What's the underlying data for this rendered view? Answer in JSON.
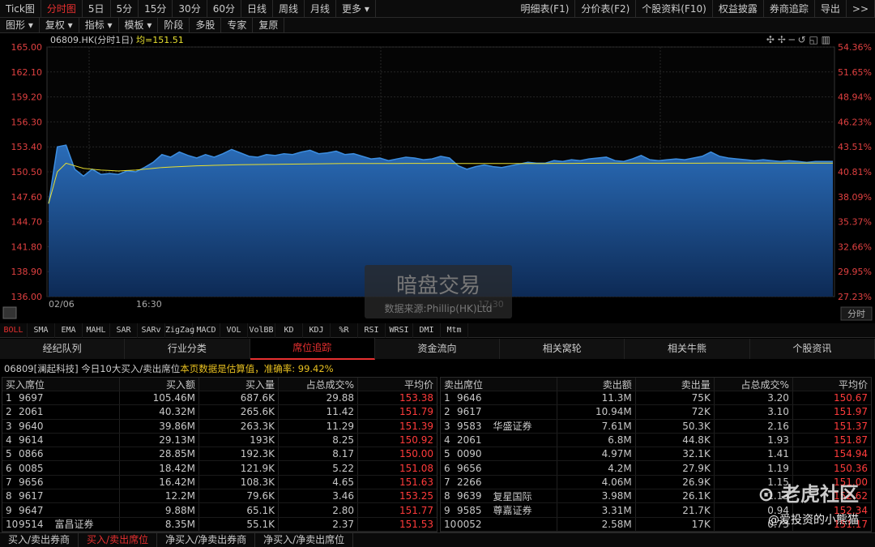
{
  "top_tabs": [
    "Tick图",
    "分时图",
    "5日",
    "5分",
    "15分",
    "30分",
    "60分",
    "日线",
    "周线",
    "月线",
    "更多 ▾"
  ],
  "top_right": [
    "明细表(F1)",
    "分价表(F2)",
    "个股资料(F10)",
    "权益披露",
    "券商追踪",
    "导出",
    ">>"
  ],
  "sub_tabs": [
    "图形 ▾",
    "复权 ▾",
    "指标 ▾",
    "模板 ▾",
    "阶段",
    "多股",
    "专家",
    "复原"
  ],
  "chart": {
    "title": "06809.HK(分时1日)",
    "avg_label": "均=151.51",
    "y_left": [
      "165.00",
      "162.10",
      "159.20",
      "156.30",
      "153.40",
      "150.50",
      "147.60",
      "144.70",
      "141.80",
      "138.90",
      "136.00"
    ],
    "y_right": [
      "54.36%",
      "51.65%",
      "48.94%",
      "46.23%",
      "43.51%",
      "40.81%",
      "38.09%",
      "35.37%",
      "32.66%",
      "29.95%",
      "27.23%"
    ],
    "x_labels": [
      "02/06",
      "16:30",
      "17:30"
    ],
    "period_btn": "分时",
    "watermark_title": "暗盘交易",
    "watermark_sub": "数据来源:Phillip(HK)Ltd",
    "toolbar": "✣ ✢ ─ ↺ ◱ ▥",
    "colors": {
      "fill": "#1e5a9e",
      "line": "#3d8ee0",
      "avg": "#e8e030",
      "ylabel": "#e04040"
    }
  },
  "chart_data": {
    "type": "area",
    "ylim": [
      136.0,
      165.0
    ],
    "price": [
      146.8,
      153.4,
      153.6,
      150.8,
      150.0,
      150.8,
      150.2,
      150.3,
      150.2,
      150.6,
      150.5,
      151.0,
      151.6,
      152.5,
      152.2,
      152.8,
      152.4,
      152.1,
      152.5,
      152.2,
      152.6,
      153.1,
      152.7,
      152.3,
      152.2,
      152.5,
      152.4,
      152.6,
      152.5,
      152.8,
      153.0,
      152.6,
      152.7,
      152.9,
      152.5,
      152.6,
      152.3,
      152.0,
      152.1,
      151.8,
      152.0,
      152.2,
      152.1,
      151.9,
      152.0,
      152.3,
      152.1,
      151.2,
      150.8,
      151.1,
      151.3,
      151.1,
      151.0,
      151.2,
      151.4,
      151.6,
      151.5,
      151.5,
      151.8,
      151.7,
      151.9,
      151.8,
      152.0,
      152.1,
      152.2,
      151.8,
      151.7,
      152.0,
      152.4,
      151.9,
      151.8,
      151.9,
      152.0,
      151.9,
      152.1,
      152.3,
      152.8,
      152.3,
      152.1,
      152.0,
      151.9,
      151.8,
      151.9,
      151.8,
      151.7,
      151.8,
      151.7,
      151.6,
      151.7,
      151.7,
      151.7
    ],
    "average": [
      146.8,
      150.5,
      151.5,
      151.2,
      150.9,
      150.8,
      150.7,
      150.65,
      150.6,
      150.65,
      150.7,
      150.8,
      150.9,
      151.0,
      151.05,
      151.1,
      151.15,
      151.2,
      151.22,
      151.25,
      151.28,
      151.3,
      151.32,
      151.34,
      151.35,
      151.36,
      151.37,
      151.38,
      151.4,
      151.41,
      151.42,
      151.43,
      151.44,
      151.45,
      151.46,
      151.47,
      151.47,
      151.47,
      151.47,
      151.47,
      151.47,
      151.48,
      151.48,
      151.48,
      151.48,
      151.48,
      151.48,
      151.47,
      151.46,
      151.46,
      151.46,
      151.46,
      151.46,
      151.46,
      151.46,
      151.47,
      151.47,
      151.47,
      151.48,
      151.48,
      151.48,
      151.49,
      151.49,
      151.49,
      151.5,
      151.5,
      151.5,
      151.5,
      151.5,
      151.5,
      151.5,
      151.5,
      151.5,
      151.5,
      151.5,
      151.5,
      151.51,
      151.51,
      151.51,
      151.51,
      151.51,
      151.51,
      151.51,
      151.51,
      151.51,
      151.51,
      151.51,
      151.51,
      151.51,
      151.51,
      151.51
    ]
  },
  "indicators": [
    "BOLL",
    "SMA",
    "EMA",
    "MAHL",
    "SAR",
    "SARv",
    "ZigZag",
    "MACD",
    "VOL",
    "VolBB",
    "KD",
    "KDJ",
    "%R",
    "RSI",
    "WRSI",
    "DMI",
    "Mtm"
  ],
  "nav_tabs": [
    "经纪队列",
    "行业分类",
    "席位追踪",
    "资金流向",
    "相关窝轮",
    "相关牛熊",
    "个股资讯"
  ],
  "info": {
    "text": "06809[澜起科技] 今日10大买入/卖出席位 ",
    "highlight": "本页数据是估算值，准确率: 99.42%"
  },
  "buy_headers": [
    "买入席位",
    "买入额",
    "买入量",
    "占总成交%",
    "平均价"
  ],
  "buy_rows": [
    [
      "1",
      "9697",
      "",
      "105.46M",
      "687.6K",
      "29.88",
      "153.38"
    ],
    [
      "2",
      "2061",
      "",
      "40.32M",
      "265.6K",
      "11.42",
      "151.79"
    ],
    [
      "3",
      "9640",
      "",
      "39.86M",
      "263.3K",
      "11.29",
      "151.39"
    ],
    [
      "4",
      "9614",
      "",
      "29.13M",
      "193K",
      "8.25",
      "150.92"
    ],
    [
      "5",
      "0866",
      "",
      "28.85M",
      "192.3K",
      "8.17",
      "150.00"
    ],
    [
      "6",
      "0085",
      "",
      "18.42M",
      "121.9K",
      "5.22",
      "151.08"
    ],
    [
      "7",
      "9656",
      "",
      "16.42M",
      "108.3K",
      "4.65",
      "151.63"
    ],
    [
      "8",
      "9617",
      "",
      "12.2M",
      "79.6K",
      "3.46",
      "153.25"
    ],
    [
      "9",
      "9647",
      "",
      "9.88M",
      "65.1K",
      "2.80",
      "151.77"
    ],
    [
      "10",
      "9514",
      "富昌证券",
      "8.35M",
      "55.1K",
      "2.37",
      "151.53"
    ]
  ],
  "sell_headers": [
    "卖出席位",
    "卖出额",
    "卖出量",
    "占总成交%",
    "平均价"
  ],
  "sell_rows": [
    [
      "1",
      "9646",
      "",
      "11.3M",
      "75K",
      "3.20",
      "150.67"
    ],
    [
      "2",
      "9617",
      "",
      "10.94M",
      "72K",
      "3.10",
      "151.97"
    ],
    [
      "3",
      "9583",
      "华盛证券",
      "7.61M",
      "50.3K",
      "2.16",
      "151.37"
    ],
    [
      "4",
      "2061",
      "",
      "6.8M",
      "44.8K",
      "1.93",
      "151.87"
    ],
    [
      "5",
      "0090",
      "",
      "4.97M",
      "32.1K",
      "1.41",
      "154.94"
    ],
    [
      "6",
      "9656",
      "",
      "4.2M",
      "27.9K",
      "1.19",
      "150.36"
    ],
    [
      "7",
      "2266",
      "",
      "4.06M",
      "26.9K",
      "1.15",
      "151.00"
    ],
    [
      "8",
      "9639",
      "复星国际",
      "3.98M",
      "26.1K",
      "1.13",
      "152.62"
    ],
    [
      "9",
      "9585",
      "尊嘉证券",
      "3.31M",
      "21.7K",
      "0.94",
      "152.34"
    ],
    [
      "10",
      "0052",
      "",
      "2.58M",
      "17K",
      "0.73",
      "151.17"
    ]
  ],
  "bottom_tabs": [
    "买入/卖出券商",
    "买入/卖出席位",
    "净买入/净卖出券商",
    "净买入/净卖出席位"
  ],
  "watermark": {
    "brand": "⊙ 老虎社区",
    "user": "@爱投资的小熊猫"
  }
}
